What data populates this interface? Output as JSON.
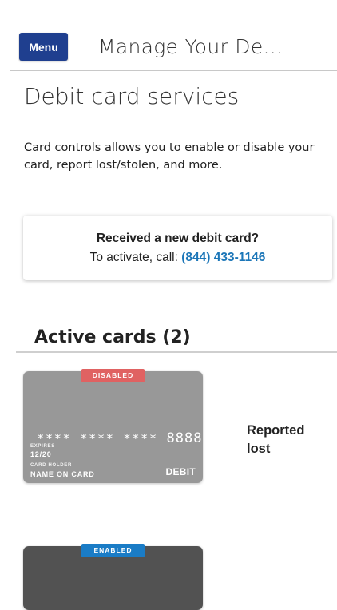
{
  "header": {
    "menu_label": "Menu",
    "title": "Manage Your De..."
  },
  "page": {
    "title": "Debit card services",
    "intro": "Card controls allows you to enable or disable your card, report lost/stolen, and more."
  },
  "notice": {
    "title": "Received a new debit card?",
    "prefix": "To activate, call:",
    "phone": "(844) 433-1146"
  },
  "section": {
    "title": "Active cards (2)"
  },
  "cards": [
    {
      "badge": "DISABLED",
      "masked": "**** **** ****",
      "last4": "8888",
      "expires_label": "EXPIRES",
      "expires": "12/20",
      "holder_label": "CARD HOLDER",
      "holder": "NAME ON CARD",
      "type": "DEBIT",
      "status": "Reported lost",
      "color": "#989898",
      "badge_color": "#e06262"
    },
    {
      "badge": "ENABLED",
      "color": "#525252",
      "badge_color": "#1a7cc6"
    }
  ],
  "colors": {
    "brand": "#1f3f8f",
    "link": "#1b76b8"
  }
}
